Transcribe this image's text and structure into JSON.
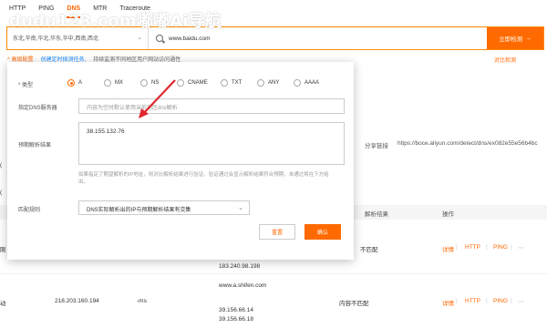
{
  "watermark": "dudu123.com嘟嘟Ai导航",
  "topnav": {
    "tabs": [
      "HTTP",
      "PING",
      "DNS",
      "MTR",
      "Traceroute"
    ],
    "active_index": 2
  },
  "search": {
    "region": "东北,华南,华北,华东,华中,西南,西北",
    "url": "www.baidu.com",
    "detect_label": "立即检测"
  },
  "advanced": {
    "label": "^ 高级配置",
    "link": "创建定时拨测任务,",
    "note": "持续监测不同地区用户网站访问通性"
  },
  "right_link": "对比检测",
  "modal": {
    "type_label": "* 类型",
    "types": [
      "A",
      "MX",
      "NS",
      "CNAME",
      "TXT",
      "ANY",
      "AAAA"
    ],
    "type_selected": "A",
    "dns_label": "指定DNS服务器",
    "dns_placeholder": "内容为空时默认使用当前地区dns解析",
    "expected_label": "预期解析结果",
    "expected_value": "38.155.132.76",
    "hint": "如果指定了期望解析的IP地址，则对比解析结果进行验证。验证通过会显示解析结果符合预期，未通过将在下方给出。",
    "rule_label": "匹配规则",
    "rule_value": "DNS实际解析出的IP与预期解析结果有交集",
    "reset_label": "重置",
    "ok_label": "确认"
  },
  "background": {
    "share_label": "分享链接",
    "share_url": "https://boce.aliyun.com/detect/dns/ex082e55e56b4bc",
    "table_headers": [
      "解析结果",
      "操作"
    ],
    "ip_row1": "183.240.98.198",
    "row2": {
      "ip": "218.203.160.194",
      "time": "-ms",
      "match": "内容不匹配",
      "host": "www.a.shifen.com",
      "ips": [
        "39.156.66.14",
        "39.156.66.18"
      ]
    },
    "row1_match": "不匹配",
    "ops": [
      "详情",
      "HTTP",
      "PING"
    ]
  }
}
